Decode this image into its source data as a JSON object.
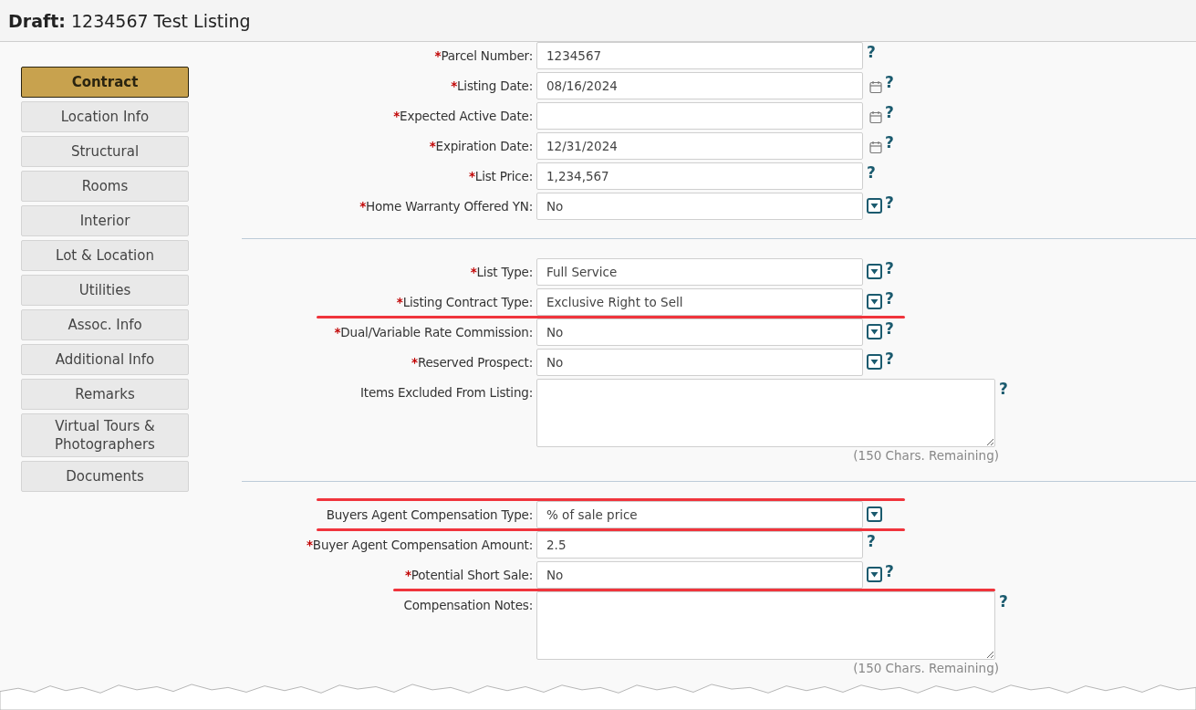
{
  "header": {
    "title": "**Draft:** 1234567 Test Listing"
  },
  "sidebar": {
    "items": [
      {
        "label": "Contract",
        "selected": true
      },
      {
        "label": "Location Info",
        "selected": false
      },
      {
        "label": "Structural",
        "selected": false
      },
      {
        "label": "Rooms",
        "selected": false
      },
      {
        "label": "Interior",
        "selected": false
      },
      {
        "label": "Lot & Location",
        "selected": false
      },
      {
        "label": "Utilities",
        "selected": false
      },
      {
        "label": "Assoc. Info",
        "selected": false
      },
      {
        "label": "Additional Info",
        "selected": false
      },
      {
        "label": "Remarks",
        "selected": false
      },
      {
        "label": "Virtual Tours & Photographers",
        "selected": false
      },
      {
        "label": "Documents",
        "selected": false
      }
    ]
  },
  "sections": [
    {
      "fields": [
        {
          "kind": "text",
          "marker": "*",
          "label": "Parcel Number:",
          "value": "1234567",
          "help": "?",
          "struck": false
        },
        {
          "kind": "date",
          "marker": "*",
          "label": "Listing Date:",
          "value": "08/16/2024",
          "help": "?",
          "struck": false
        },
        {
          "kind": "date",
          "marker": "*",
          "label": "Expected Active Date:",
          "help": "?",
          "struck": false
        },
        {
          "kind": "date",
          "marker": "*",
          "label": "Expiration Date:",
          "value": "12/31/2024",
          "help": "?",
          "struck": false
        },
        {
          "kind": "text",
          "marker": "*",
          "label": "List Price:",
          "value": "1,234,567",
          "help": "?",
          "struck": false
        },
        {
          "kind": "select",
          "marker": "*",
          "label": "Home Warranty Offered YN:",
          "value": "No",
          "help": "?",
          "struck": false
        }
      ]
    },
    {
      "fields": [
        {
          "kind": "select",
          "marker": "*",
          "label": "List Type:",
          "value": "Full Service",
          "help": "?",
          "struck": false
        },
        {
          "kind": "select",
          "marker": "*",
          "label": "Listing Contract Type:",
          "value": "Exclusive Right to Sell",
          "help": "?",
          "struck": false
        },
        {
          "kind": "select",
          "marker": "*",
          "label": "Dual/Variable Rate Commission:",
          "value": "No",
          "help": "?",
          "struck": true
        },
        {
          "kind": "select",
          "marker": "*",
          "label": "Reserved Prospect:",
          "value": "No",
          "help": "?",
          "struck": false
        },
        {
          "kind": "textarea",
          "label": "Items Excluded From Listing:",
          "help": "?",
          "remaining": "(150 Chars. Remaining)",
          "struck": false
        }
      ]
    },
    {
      "fields": [
        {
          "kind": "select",
          "label": "Buyers Agent Compensation Type:",
          "value": "% of sale price",
          "struck": true
        },
        {
          "kind": "text",
          "marker": "*",
          "label": "Buyer Agent Compensation Amount:",
          "value": "2.5",
          "help": "?",
          "struck": true
        },
        {
          "kind": "select",
          "marker": "*",
          "label": "Potential Short Sale:",
          "value": "No",
          "help": "?",
          "struck": false
        },
        {
          "kind": "textarea",
          "label": "Compensation Notes:",
          "help": "?",
          "remaining": "(150 Chars. Remaining)",
          "struck": true
        }
      ]
    }
  ]
}
